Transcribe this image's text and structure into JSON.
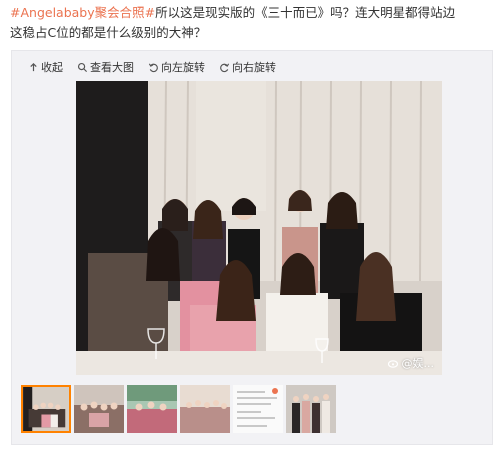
{
  "post": {
    "hashtag": "#Angelababy聚会合照#",
    "line1_rest": "所以这是现实版的《三十而已》吗？连大明星都得站边",
    "line2": "这稳占C位的都是什么级别的大神？"
  },
  "toolbar": {
    "collapse": "收起",
    "view_large": "查看大图",
    "rotate_left": "向左旋转",
    "rotate_right": "向右旋转"
  },
  "photo": {
    "watermark": "@娱..."
  },
  "thumbnails": {
    "count": 6,
    "active_index": 0
  },
  "colors": {
    "hashtag": "#eb7350",
    "active_thumb_border": "#ff8200",
    "viewer_bg": "#f2f2f5"
  }
}
